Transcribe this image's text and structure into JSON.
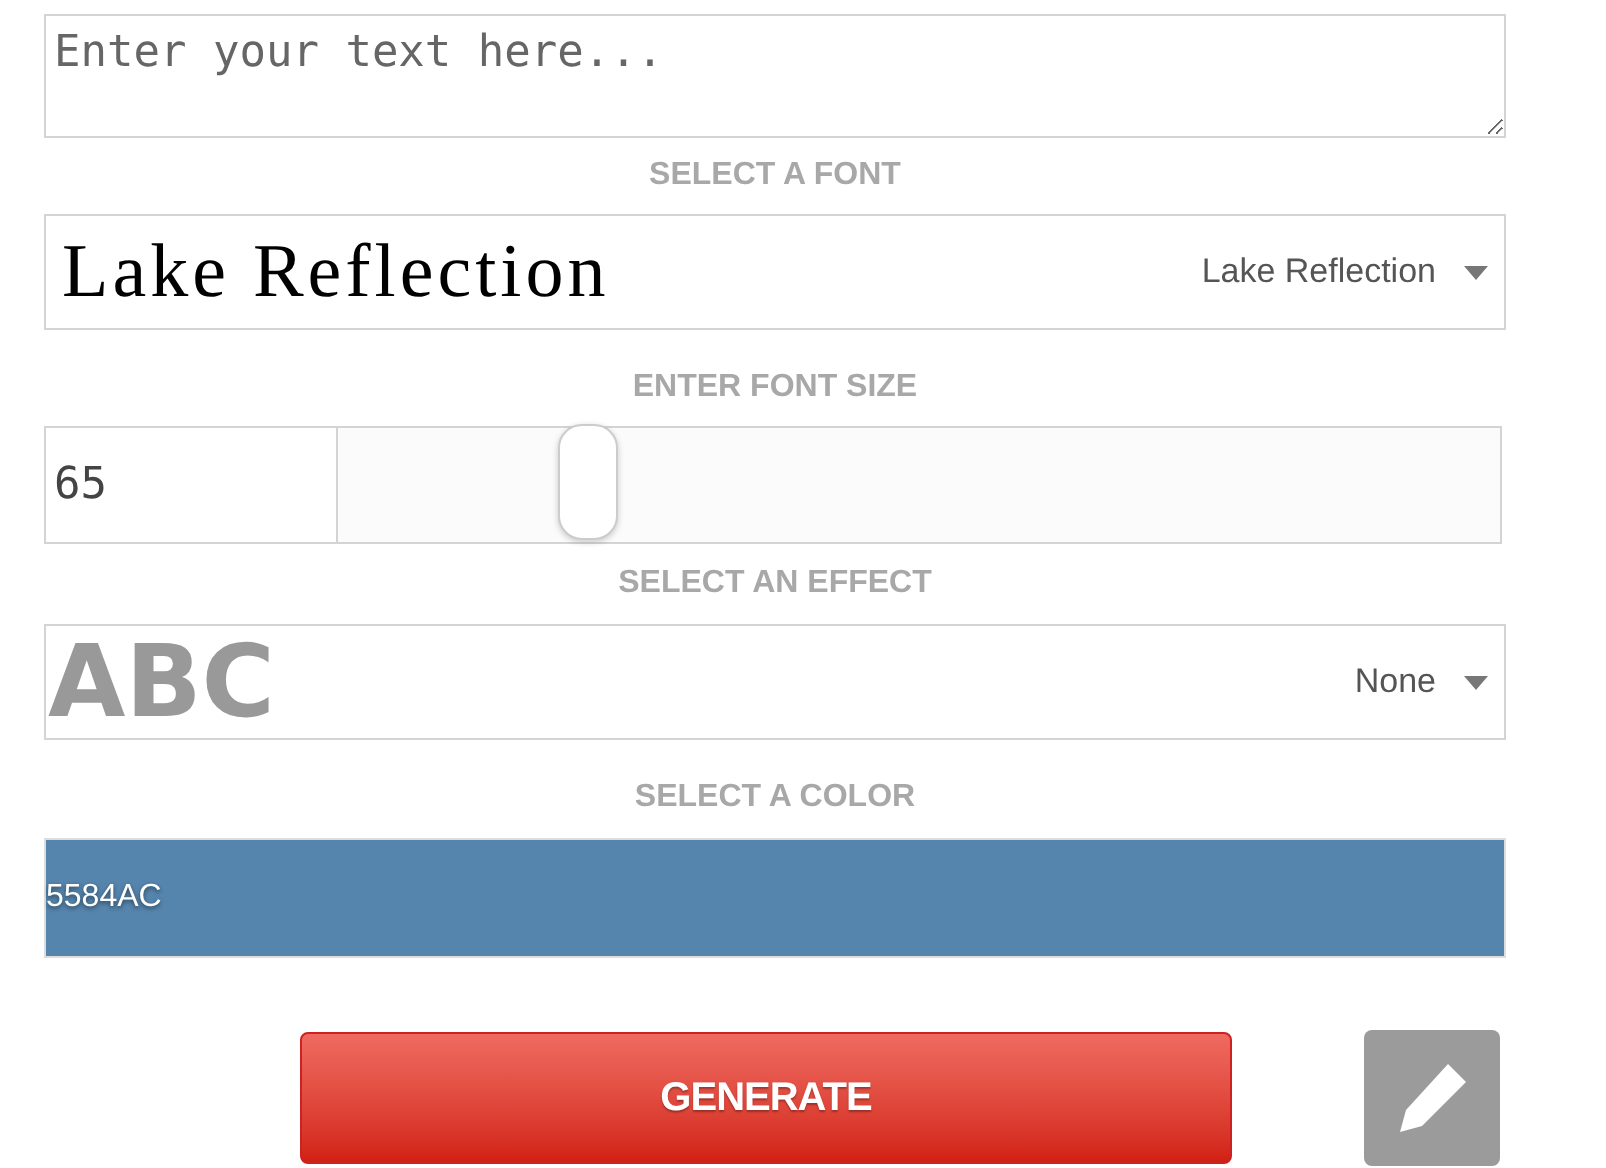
{
  "text_input": {
    "placeholder": "Enter your text here..."
  },
  "font_section": {
    "label": "SELECT A FONT",
    "preview": "Lake Reflection",
    "selected": "Lake Reflection"
  },
  "size_section": {
    "label": "ENTER FONT SIZE",
    "value": "65",
    "level": 0.215
  },
  "effect_section": {
    "label": "SELECT AN EFFECT",
    "preview": "ABC",
    "selected": "None"
  },
  "color_section": {
    "label": "SELECT A COLOR",
    "value": "5584AC"
  },
  "generate_button": {
    "label": "GENERATE"
  }
}
